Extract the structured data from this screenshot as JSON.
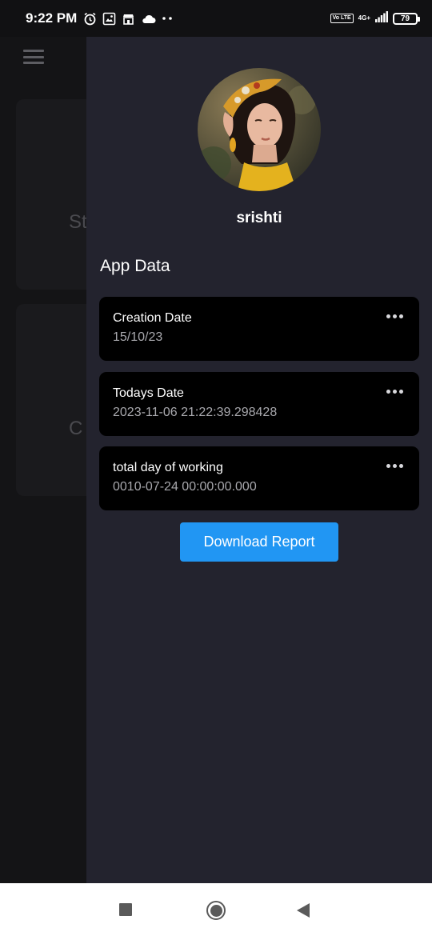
{
  "status_bar": {
    "time": "9:22 PM",
    "network": "4G+",
    "volte": "Vo LTE",
    "battery": "79",
    "icons_left": [
      "alarm-icon",
      "gallery-icon",
      "store-icon",
      "cloud-icon",
      "more-dots-icon"
    ]
  },
  "background": {
    "menu_icon": "hamburger-menu-icon",
    "card1_text": "St",
    "card2_text": "C"
  },
  "drawer": {
    "username": "srishti",
    "section_title": "App Data",
    "cards": [
      {
        "title": "Creation Date",
        "value": "15/10/23"
      },
      {
        "title": "Todays Date",
        "value": "2023-11-06 21:22:39.298428"
      },
      {
        "title": "total day of working",
        "value": "0010-07-24 00:00:00.000"
      }
    ],
    "download_button": "Download Report"
  },
  "colors": {
    "drawer_bg": "#23232e",
    "card_bg": "#000000",
    "accent": "#2196f3"
  }
}
